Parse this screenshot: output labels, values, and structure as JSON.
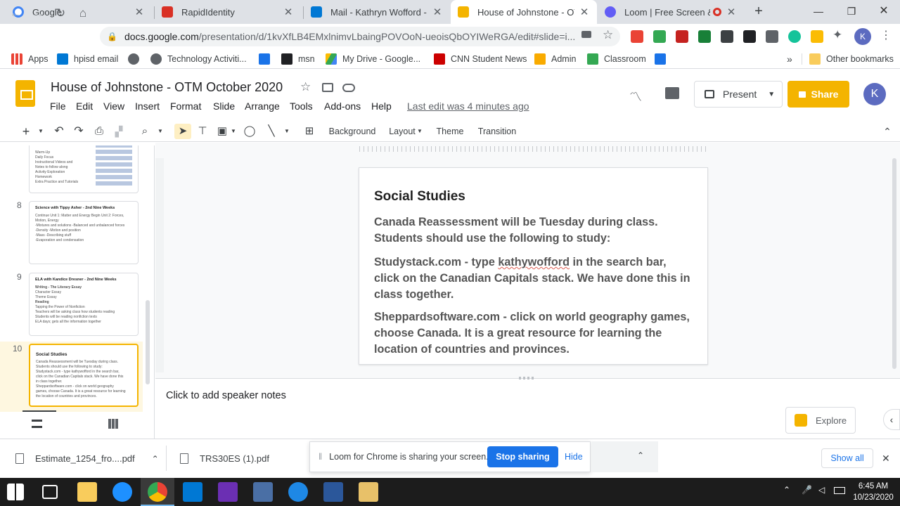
{
  "browser": {
    "tabs": [
      {
        "title": "Google",
        "favicon": "google-icon",
        "color": "#4285f4"
      },
      {
        "title": "RapidIdentity",
        "favicon": "rapididentity-icon",
        "color": "#d93025"
      },
      {
        "title": "Mail - Kathryn Wofford - Ou",
        "favicon": "outlook-icon",
        "color": "#0078d4"
      },
      {
        "title": "House of Johnstone - OTM",
        "favicon": "slides-icon",
        "color": "#f4b400",
        "active": true
      },
      {
        "title": "Loom | Free Screen & V",
        "favicon": "loom-icon",
        "color": "#625df5"
      }
    ],
    "new_tab": "+",
    "url_host": "docs.google.com",
    "url_path": "/presentation/d/1kvXfLB4EMxlnimvLbaingPOVOoN-ueoisQbOYIWeRGA/edit#slide=i...",
    "profile_initial": "K",
    "bookmarks": [
      {
        "label": "Apps",
        "icon": "apps-grid-icon"
      },
      {
        "label": "hpisd email",
        "icon": "outlook-icon"
      },
      {
        "label": "",
        "icon": "globe-icon"
      },
      {
        "label": "Technology Activiti...",
        "icon": "globe-icon"
      },
      {
        "label": "",
        "icon": "calendar-icon"
      },
      {
        "label": "msn",
        "icon": "msn-icon"
      },
      {
        "label": "My Drive - Google...",
        "icon": "drive-icon"
      },
      {
        "label": "CNN Student News",
        "icon": "cnn-icon"
      },
      {
        "label": "Admin",
        "icon": "admin-icon"
      },
      {
        "label": "Classroom",
        "icon": "classroom-icon"
      },
      {
        "label": "",
        "icon": "calendar-icon"
      }
    ],
    "more_bookmarks": "»",
    "other_bookmarks": "Other bookmarks"
  },
  "slides": {
    "doc_title": "House of Johnstone - OTM October 2020",
    "menus": [
      "File",
      "Edit",
      "View",
      "Insert",
      "Format",
      "Slide",
      "Arrange",
      "Tools",
      "Add-ons",
      "Help"
    ],
    "last_edit": "Last edit was 4 minutes ago",
    "present_label": "Present",
    "share_label": "Share",
    "avatar_initial": "K",
    "toolbar": {
      "background": "Background",
      "layout": "Layout",
      "theme": "Theme",
      "transition": "Transition"
    },
    "filmstrip": [
      {
        "num": "",
        "title": "",
        "lines": [
          "Warm-Up",
          "Daily Focus",
          "Instructional Videos and",
          "Notes to follow along",
          "Activity Exploration",
          "Homework",
          "Extra Practice and Tutorials"
        ]
      },
      {
        "num": "8",
        "title": "Science with Tippy Asher - 2nd Nine Weeks",
        "lines": [
          "Continue Unit 1: Matter and Energy    Begin Unit 2: Forces, Motion, Energy",
          "-Mixtures and solutions    -Balanced and unbalanced forces",
          "-Density    -Motion and position",
          "-Mass    -Describing stuff",
          "-Evaporation and condensation"
        ]
      },
      {
        "num": "9",
        "title": "ELA with Kandice Dresner - 2nd Nine Weeks",
        "lines": [
          "Writing - The Literary Essay",
          "Character Essay",
          "Theme Essay",
          "Reading",
          "Tapping the Power of Nonfiction",
          "Teachers will be asking class how students reading",
          "Students will be reading nonfiction texts",
          "ELA days; gets all the information together"
        ]
      },
      {
        "num": "10",
        "title": "Social Studies",
        "lines": [
          "Canada Reassessment will be Tuesday during class.",
          "Students should use the following to study:",
          "Studystack.com - type kathywofford in the search bar,",
          "click on the Canadian Capitals stack. We have done this",
          "in class together.",
          "Sheppardsoftware.com - click on world geography",
          "games, choose Canada. It is a great resource for learning",
          "the location of countries and provinces."
        ],
        "selected": true
      }
    ],
    "slide": {
      "title": "Social Studies",
      "p1": "Canada Reassessment will be Tuesday during class. Students should use the following to study:",
      "p2_before": "Studystack.com - type ",
      "p2_misspelled": "kathywofford",
      "p2_after": " in the search bar, click on the Canadian Capitals stack. We have done this in class together.",
      "p3": "Sheppardsoftware.com - click on world geography games, choose Canada. It is a great resource for learning the location of countries and provinces."
    },
    "notes_placeholder": "Click to add speaker notes",
    "explore_label": "Explore"
  },
  "downloads": {
    "items": [
      "Estimate_1254_fro....pdf",
      "TRS30ES (1).pdf"
    ],
    "loom_message": "Loom for Chrome is sharing your screen.",
    "stop_sharing": "Stop sharing",
    "hide": "Hide",
    "show_all": "Show all"
  },
  "taskbar": {
    "time": "6:45 AM",
    "date": "10/23/2020"
  },
  "colors": {
    "slides_yellow": "#f4b400",
    "link_blue": "#1a73e8",
    "selected_thumb": "#fef7e0"
  }
}
